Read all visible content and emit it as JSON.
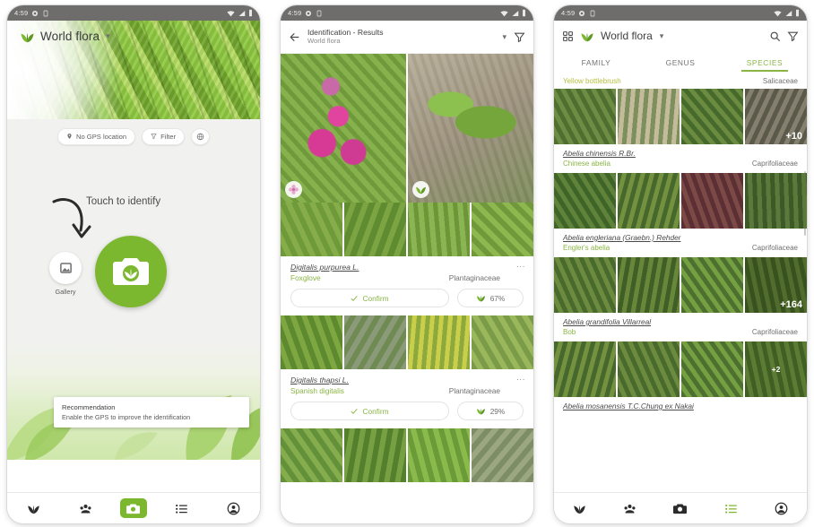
{
  "status_bar": {
    "time": "4:59",
    "icons": [
      "alarm-icon",
      "app-icon",
      "wifi-icon",
      "signal-icon",
      "battery-icon"
    ]
  },
  "colors": {
    "accent_green": "#7cb82f",
    "text_green": "#8ab545",
    "yellow_green": "#b6bf3e",
    "status_bar": "#6e6d6b"
  },
  "screen1": {
    "brand_title": "World flora",
    "chips": [
      {
        "label": "No GPS location",
        "icon": "location-pin-icon"
      },
      {
        "label": "Filter",
        "icon": "filter-icon"
      },
      {
        "label": "",
        "icon": "globe-icon"
      }
    ],
    "hint_text": "Touch to identify",
    "gallery_label": "Gallery",
    "camera_button": "camera-button",
    "snackbar": {
      "title": "Recommendation",
      "message": "Enable the GPS to improve the identification"
    },
    "nav": [
      {
        "name": "plant-tab",
        "icon": "plant-icon",
        "active": false
      },
      {
        "name": "community-tab",
        "icon": "community-icon",
        "active": false
      },
      {
        "name": "camera-tab",
        "icon": "camera-icon",
        "active": true
      },
      {
        "name": "list-tab",
        "icon": "list-icon",
        "active": false
      },
      {
        "name": "profile-tab",
        "icon": "account-icon",
        "active": false
      }
    ]
  },
  "screen2": {
    "title": "Identification - Results",
    "subtitle": "World flora",
    "back_icon": "back-arrow-icon",
    "filter_icon": "filter-icon",
    "query_images": [
      {
        "name": "query-photo-flower",
        "organ_badge": "flower-icon"
      },
      {
        "name": "query-photo-leaf",
        "organ_badge": "leaf-icon"
      }
    ],
    "results": [
      {
        "scientific_name": "Digitalis purpurea L.",
        "common_name": "Foxglove",
        "family": "Plantaginaceae",
        "confirm_label": "Confirm",
        "score": "67%",
        "thumbnails": [
          "t-fox1",
          "t-fox2",
          "t-fox3",
          "t-fox4"
        ]
      },
      {
        "scientific_name": "Digitalis thapsi L.",
        "common_name": "Spanish digitalis",
        "family": "Plantaginaceae",
        "confirm_label": "Confirm",
        "score": "29%",
        "thumbnails": [
          "t-mix1",
          "t-mix2",
          "t-mix3",
          "t-mix4"
        ]
      }
    ],
    "bottom_thumbnails": [
      "t-grn1",
      "t-grn2",
      "t-grn3",
      "t-grn4"
    ]
  },
  "screen3": {
    "grid_icon": "grid-icon",
    "brand_title": "World flora",
    "search_icon": "search-icon",
    "filter_icon": "filter-icon",
    "tabs": [
      {
        "label": "FAMILY",
        "active": false
      },
      {
        "label": "GENUS",
        "active": false
      },
      {
        "label": "SPECIES",
        "active": true
      }
    ],
    "sticky_header": {
      "left": "Yellow bottlebrush",
      "right": "Salicaceae"
    },
    "species": [
      {
        "scientific_name": "Abelia chinensis R.Br.",
        "common_name": "Chinese abelia",
        "family": "Caprifoliaceae",
        "more_badge": "+10",
        "images": [
          "i-ab1",
          "i-ab2",
          "i-ab3",
          "i-ab4"
        ]
      },
      {
        "scientific_name": "Abelia engleriana (Graebn.) Rehder",
        "common_name": "Engler's abelia",
        "family": "Caprifoliaceae",
        "more_badge": "+164",
        "images": [
          "i-en1",
          "i-en2",
          "i-en3",
          "i-en4"
        ]
      },
      {
        "scientific_name": "Abelia grandifolia Villarreal",
        "common_name": "Bob",
        "family": "Caprifoliaceae",
        "more_badge": "+2",
        "images": [
          "i-gr1",
          "i-gr2",
          "i-gr3",
          "i-gr4"
        ]
      },
      {
        "scientific_name": "Abelia mosanensis T.C.Chung ex Nakai",
        "common_name": "",
        "family": "",
        "more_badge": "",
        "images": []
      }
    ],
    "nav": [
      {
        "name": "plant-tab",
        "icon": "plant-icon",
        "active": false
      },
      {
        "name": "community-tab",
        "icon": "community-icon",
        "active": false
      },
      {
        "name": "camera-tab",
        "icon": "camera-icon",
        "active": false
      },
      {
        "name": "list-tab",
        "icon": "list-icon",
        "active": true
      },
      {
        "name": "profile-tab",
        "icon": "account-icon",
        "active": false
      }
    ]
  }
}
